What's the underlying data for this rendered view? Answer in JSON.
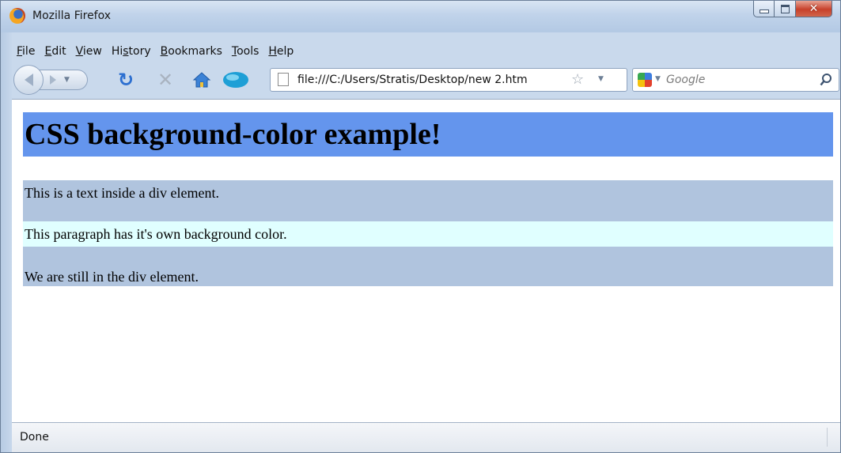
{
  "window": {
    "title": "Mozilla Firefox"
  },
  "menubar": {
    "items": [
      {
        "accel": "F",
        "rest": "ile"
      },
      {
        "accel": "E",
        "rest": "dit"
      },
      {
        "accel": "V",
        "rest": "iew"
      },
      {
        "pre": "Hi",
        "accel": "s",
        "rest": "tory"
      },
      {
        "accel": "B",
        "rest": "ookmarks"
      },
      {
        "accel": "T",
        "rest": "ools"
      },
      {
        "accel": "H",
        "rest": "elp"
      }
    ]
  },
  "toolbar": {
    "url": "file:///C:/Users/Stratis/Desktop/new  2.htm",
    "search_placeholder": "Google",
    "icons": [
      "back-icon",
      "forward-icon",
      "reload-icon",
      "stop-icon",
      "home-icon",
      "addon-icon",
      "page-icon",
      "bookmark-star-icon",
      "google-icon",
      "search-icon"
    ]
  },
  "page": {
    "heading": "CSS background-color example!",
    "div_text_1": "This is a text inside a div element.",
    "paragraph": "This paragraph has it's own background color.",
    "div_text_2": "We are still in the div element.",
    "colors": {
      "heading_bg": "#6495ed",
      "div_bg": "#b0c4de",
      "paragraph_bg": "#e0ffff"
    }
  },
  "statusbar": {
    "text": "Done"
  }
}
